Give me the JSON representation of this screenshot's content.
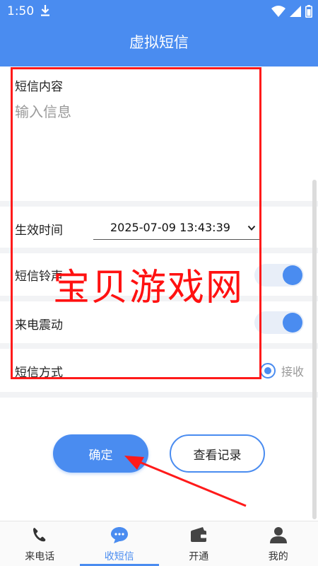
{
  "status_bar": {
    "time": "1:50"
  },
  "header": {
    "title": "虚拟短信"
  },
  "form": {
    "sms_label": "短信内容",
    "sms_placeholder": "输入信息",
    "sms_value": "",
    "effective_time_label": "生效时间",
    "effective_time_value": "2025-07-09 13:43:39",
    "ringtone_label": "短信铃声",
    "ringtone_on": true,
    "vibrate_label": "来电震动",
    "vibrate_on": true,
    "mode_label": "短信方式",
    "mode_option": "接收",
    "mode_selected": true
  },
  "actions": {
    "confirm": "确定",
    "records": "查看记录"
  },
  "overlay": {
    "watermark": "宝贝游戏网"
  },
  "tabs": [
    {
      "label": "来电话",
      "icon": "phone-icon",
      "active": false
    },
    {
      "label": "收短信",
      "icon": "chat-bubble-icon",
      "active": true
    },
    {
      "label": "开通",
      "icon": "wallet-icon",
      "active": false
    },
    {
      "label": "我的",
      "icon": "user-icon",
      "active": false
    }
  ],
  "colors": {
    "accent": "#4a8cf0",
    "annotation": "#ff1a1a",
    "separator": "#f2f3f5"
  }
}
